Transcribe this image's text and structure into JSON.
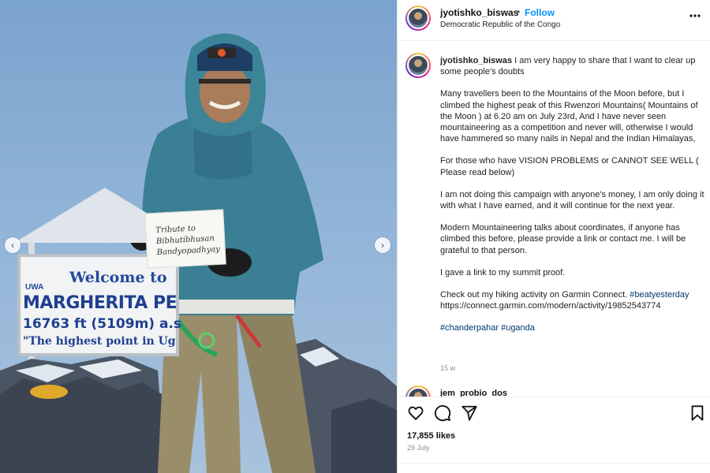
{
  "post": {
    "username": "jyotishko_biswas",
    "separator": "•",
    "follow_label": "Follow",
    "location": "Democratic Republic of the Congo",
    "more_icon": "more-options-icon"
  },
  "photo": {
    "sign": {
      "welcome": "Welcome to",
      "org": "UWA",
      "name": "MARGHERITA PE",
      "height": "16763 ft (5109m) a.s",
      "tagline": "\"The highest point in Ug"
    },
    "paper_note": "Tribute to Bibhutibhusan Bandyopadhyay",
    "prev_label": "‹",
    "next_label": "›"
  },
  "caption": {
    "username": "jyotishko_biswas",
    "intro": "I am very happy to share that I want to clear up some people's doubts",
    "para1": "Many travellers been to the Mountains of the Moon before, but I climbed the highest peak of this Rwenzori Mountains( Mountains of the Moon ) at 6.20 am on July 23rd, And I have never seen mountaineering as a competition and never will, otherwise I would have hammered so many nails in Nepal and the Indian Himalayas,",
    "para2": "For those who have VISION PROBLEMS or CANNOT SEE WELL ( Please read below)",
    "para3": "I am not doing this campaign with anyone's money, I am only doing it with what I have earned, and it will continue for the next year.",
    "para4": "Modern Mountaineering talks about coordinates, if anyone has climbed this before, please provide a link or contact me. I will be grateful to that person.",
    "para5": "I gave a link to my summit proof.",
    "para6_text": "Check out my hiking activity on Garmin Connect.",
    "para6_tag": "#beatyesterday",
    "para6_link": "https://connect.garmin.com/modern/activity/19852543774",
    "tag1": "#chanderpahar",
    "tag2": "#uganda",
    "time": "15 w"
  },
  "next_comment": {
    "username": "jem_probio_dos"
  },
  "actions": {
    "likes": "17,855 likes",
    "date": "29 July"
  },
  "colors": {
    "accent": "#0095f6",
    "hashtag": "#00376b",
    "muted": "#8e8e8e"
  }
}
